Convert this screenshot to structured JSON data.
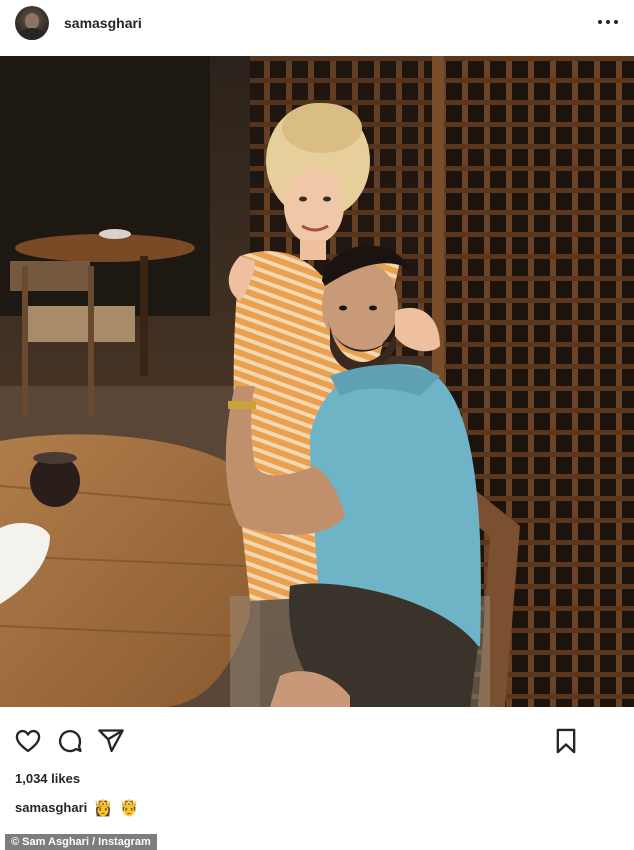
{
  "post": {
    "username": "samasghari",
    "photo_alt_subject": "couple-at-restaurant-photo"
  },
  "actions": {
    "like_icon": "heart-icon",
    "comment_icon": "comment-bubble-icon",
    "share_icon": "paper-plane-icon",
    "save_icon": "bookmark-icon",
    "more_icon": "ellipsis-icon"
  },
  "likes": {
    "count_text": "1,034 likes"
  },
  "caption": {
    "username": "samasghari",
    "emoji_1": "👸",
    "emoji_2": "🤴"
  },
  "credit": {
    "text": "© Sam Asghari / Instagram"
  },
  "colors": {
    "text": "#262626",
    "credit_bg": "#7d7d7d"
  }
}
